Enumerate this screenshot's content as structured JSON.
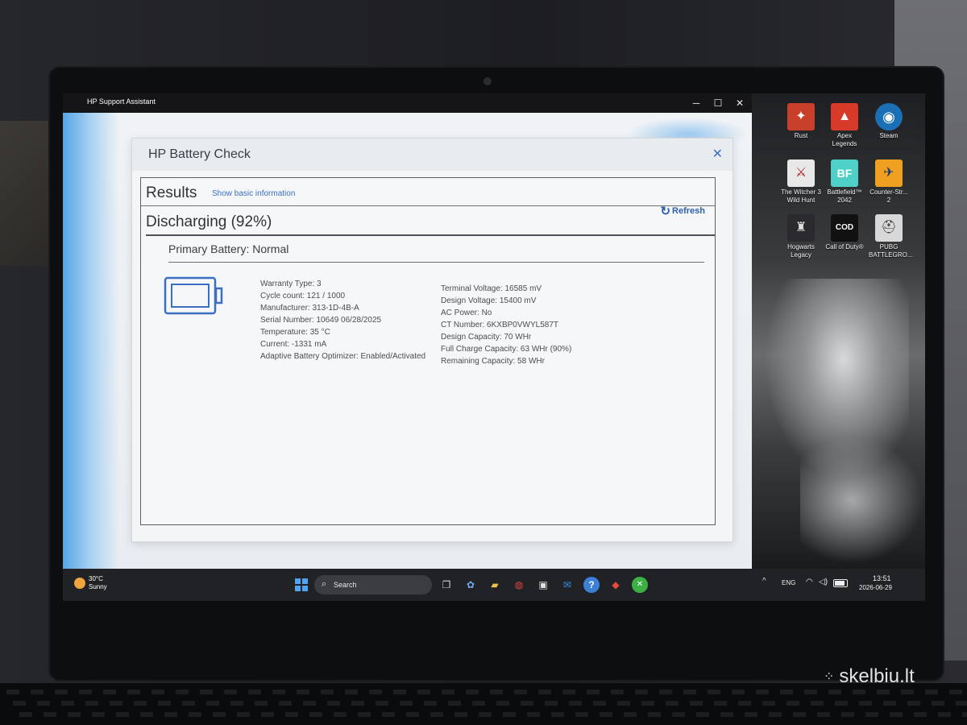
{
  "window": {
    "title": "HP Support Assistant",
    "controls": {
      "minimize": "─",
      "maximize": "☐",
      "close": "✕"
    }
  },
  "dialog": {
    "title": "HP Battery Check",
    "close": "✕",
    "results_title": "Results",
    "show_basic_link": "Show basic information",
    "refresh_label": "Refresh",
    "status_heading": "Discharging (92%)",
    "primary_battery": "Primary Battery: Normal",
    "details_left": [
      "Warranty Type: 3",
      "Cycle count: 121 / 1000",
      "Manufacturer: 313-1D-4B-A",
      "Serial Number: 10649 06/28/2025",
      "Temperature: 35 °C",
      "Current: -1331 mA",
      "Adaptive Battery Optimizer: Enabled/Activated"
    ],
    "details_right": [
      "Terminal Voltage: 16585 mV",
      "Design Voltage: 15400 mV",
      "AC Power: No",
      "CT Number: 6KXBP0VWYL587T",
      "Design Capacity: 70 WHr",
      "Full Charge Capacity: 63 WHr (90%)",
      "Remaining Capacity: 58 WHr"
    ],
    "accent_color": "#2b5fb0"
  },
  "desktop": {
    "icons": [
      {
        "label": "Rust",
        "color": "#c8402a",
        "glyph": "✦"
      },
      {
        "label": "Apex Legends",
        "color": "#d83a2a",
        "glyph": "▲"
      },
      {
        "label": "Steam",
        "color": "#1b6fb5",
        "glyph": "◉"
      },
      {
        "label": "The Witcher 3 Wild Hunt",
        "color": "#e8e8e8",
        "glyph": "⚔"
      },
      {
        "label": "Battlefield™ 2042",
        "color": "#4ed0c8",
        "glyph": "BF"
      },
      {
        "label": "Counter-Str... 2",
        "color": "#f0a020",
        "glyph": "✈"
      },
      {
        "label": "Hogwarts Legacy",
        "color": "#2a2a2e",
        "glyph": "♜"
      },
      {
        "label": "Call of Duty®",
        "color": "#111111",
        "glyph": "COD"
      },
      {
        "label": "PUBG BATTLEGRO...",
        "color": "#d8d8d8",
        "glyph": "⛑"
      }
    ]
  },
  "taskbar": {
    "weather_temp": "30°C",
    "weather_condition": "Sunny",
    "search_label": "Search",
    "search_icon": "⌕",
    "pinned": [
      {
        "name": "task-view",
        "glyph": "❐",
        "color": "#cfd3d8"
      },
      {
        "name": "copilot",
        "glyph": "✿",
        "color": "#6fa8f5"
      },
      {
        "name": "file-explorer",
        "glyph": "▰",
        "color": "#f3c24a"
      },
      {
        "name": "chrome",
        "glyph": "◍",
        "color": "#e8453c"
      },
      {
        "name": "store",
        "glyph": "▣",
        "color": "#e0e0e0"
      },
      {
        "name": "mail",
        "glyph": "✉",
        "color": "#3a8fe0"
      },
      {
        "name": "hp-support-assistant",
        "glyph": "?",
        "color": "#3b7fd6"
      },
      {
        "name": "game-app",
        "glyph": "◆",
        "color": "#e84a3a"
      },
      {
        "name": "xbox",
        "glyph": "✕",
        "color": "#3cb043"
      }
    ],
    "tray": {
      "chevron": "^",
      "language": "ENG",
      "wifi": "◠",
      "volume": "◁)",
      "time": "13:51",
      "date": "2026-06-29"
    }
  },
  "watermark": {
    "dots": "⁘",
    "text": "skelbiu.lt"
  }
}
